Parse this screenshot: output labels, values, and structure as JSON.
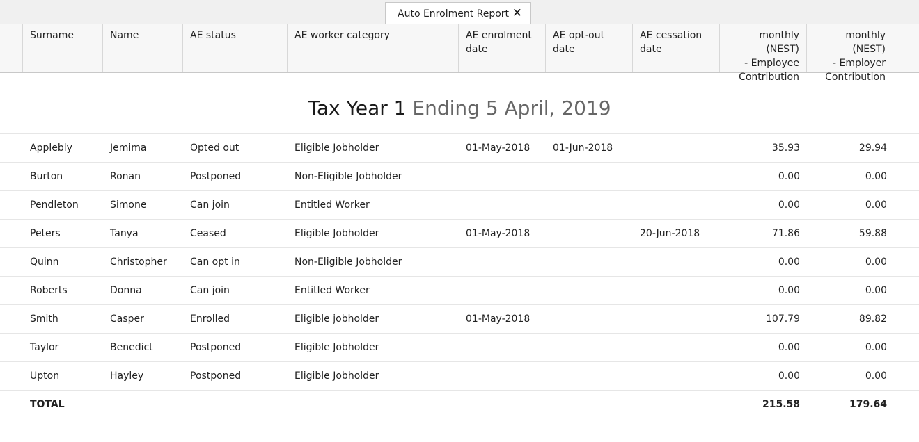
{
  "tab": {
    "label": "Auto Enrolment Report",
    "close": "✕"
  },
  "columns": {
    "surname": "Surname",
    "name": "Name",
    "status": "AE status",
    "category": "AE worker category",
    "enrolment": "AE enrolment\ndate",
    "optout": "AE opt-out\ndate",
    "cessation": "AE cessation\ndate",
    "employee": "monthly (NEST)\n- Employee\nContribution",
    "employer": "monthly (NEST)\n- Employer\nContribution"
  },
  "section": {
    "tax_year": "Tax Year 1",
    "ending": "Ending 5 April, 2019"
  },
  "rows": [
    {
      "surname": "Applebly",
      "name": "Jemima",
      "status": "Opted out",
      "category": "Eligible Jobholder",
      "enrolment": "01-May-2018",
      "optout": "01-Jun-2018",
      "cessation": "",
      "employee": "35.93",
      "employer": "29.94"
    },
    {
      "surname": "Burton",
      "name": "Ronan",
      "status": "Postponed",
      "category": "Non-Eligible Jobholder",
      "enrolment": "",
      "optout": "",
      "cessation": "",
      "employee": "0.00",
      "employer": "0.00"
    },
    {
      "surname": "Pendleton",
      "name": "Simone",
      "status": "Can join",
      "category": "Entitled Worker",
      "enrolment": "",
      "optout": "",
      "cessation": "",
      "employee": "0.00",
      "employer": "0.00"
    },
    {
      "surname": "Peters",
      "name": "Tanya",
      "status": "Ceased",
      "category": "Eligible Jobholder",
      "enrolment": "01-May-2018",
      "optout": "",
      "cessation": "20-Jun-2018",
      "employee": "71.86",
      "employer": "59.88"
    },
    {
      "surname": "Quinn",
      "name": "Christopher",
      "status": "Can opt in",
      "category": "Non-Eligible Jobholder",
      "enrolment": "",
      "optout": "",
      "cessation": "",
      "employee": "0.00",
      "employer": "0.00"
    },
    {
      "surname": "Roberts",
      "name": "Donna",
      "status": "Can join",
      "category": "Entitled Worker",
      "enrolment": "",
      "optout": "",
      "cessation": "",
      "employee": "0.00",
      "employer": "0.00"
    },
    {
      "surname": "Smith",
      "name": "Casper",
      "status": "Enrolled",
      "category": "Eligible jobholder",
      "enrolment": "01-May-2018",
      "optout": "",
      "cessation": "",
      "employee": "107.79",
      "employer": "89.82"
    },
    {
      "surname": "Taylor",
      "name": "Benedict",
      "status": "Postponed",
      "category": "Eligible Jobholder",
      "enrolment": "",
      "optout": "",
      "cessation": "",
      "employee": "0.00",
      "employer": "0.00"
    },
    {
      "surname": "Upton",
      "name": "Hayley",
      "status": "Postponed",
      "category": "Eligible Jobholder",
      "enrolment": "",
      "optout": "",
      "cessation": "",
      "employee": "0.00",
      "employer": "0.00"
    }
  ],
  "total": {
    "label": "TOTAL",
    "employee": "215.58",
    "employer": "179.64"
  }
}
